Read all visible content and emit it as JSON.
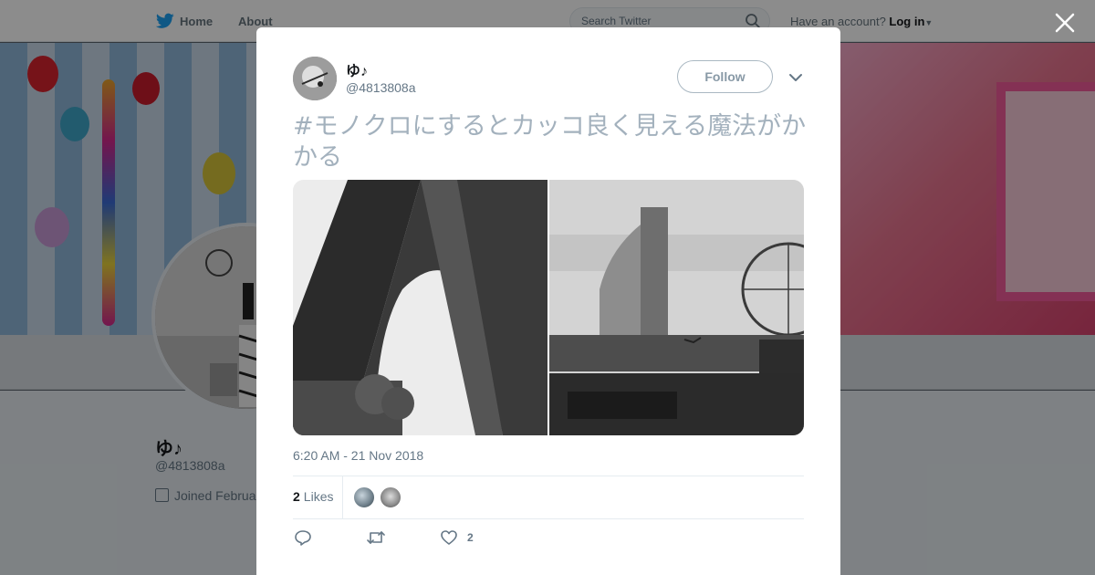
{
  "background": {
    "nav": {
      "home_label": "Home",
      "about_label": "About",
      "search_placeholder": "Search Twitter",
      "account_prompt": "Have an account?",
      "login_label": "Log in"
    },
    "profile": {
      "name": "ゆ♪",
      "handle": "@4813808a",
      "joined_text": "Joined Februa"
    }
  },
  "tweet": {
    "author_name": "ゆ♪",
    "author_handle": "@4813808a",
    "follow_label": "Follow",
    "text": "#モノクロにするとカッコ良く見える魔法がかかる",
    "timestamp": "6:20 AM - 21 Nov 2018",
    "likes_count": "2",
    "likes_label": "Likes",
    "action_like_count": "2"
  },
  "colors": {
    "brand": "#1da1f2",
    "muted_text": "#657786",
    "tweet_text": "#a3b1bd"
  },
  "icons": [
    "twitter-bird-icon",
    "search-icon",
    "close-icon",
    "chevron-down-icon",
    "calendar-icon",
    "reply-icon",
    "retweet-icon",
    "heart-icon"
  ]
}
